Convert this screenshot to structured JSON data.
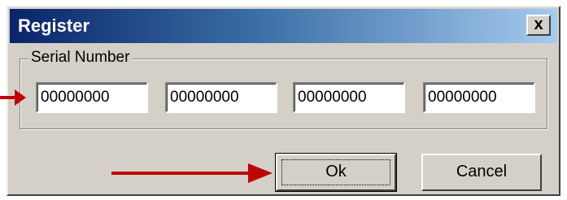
{
  "window": {
    "title": "Register",
    "close_label": "x",
    "icon": "close-icon"
  },
  "serial_group": {
    "label": "Serial Number",
    "fields": [
      "00000000",
      "00000000",
      "00000000",
      "00000000"
    ]
  },
  "buttons": {
    "ok_label": "Ok",
    "cancel_label": "Cancel"
  },
  "annotations": {
    "arrow_color": "#c00000"
  }
}
